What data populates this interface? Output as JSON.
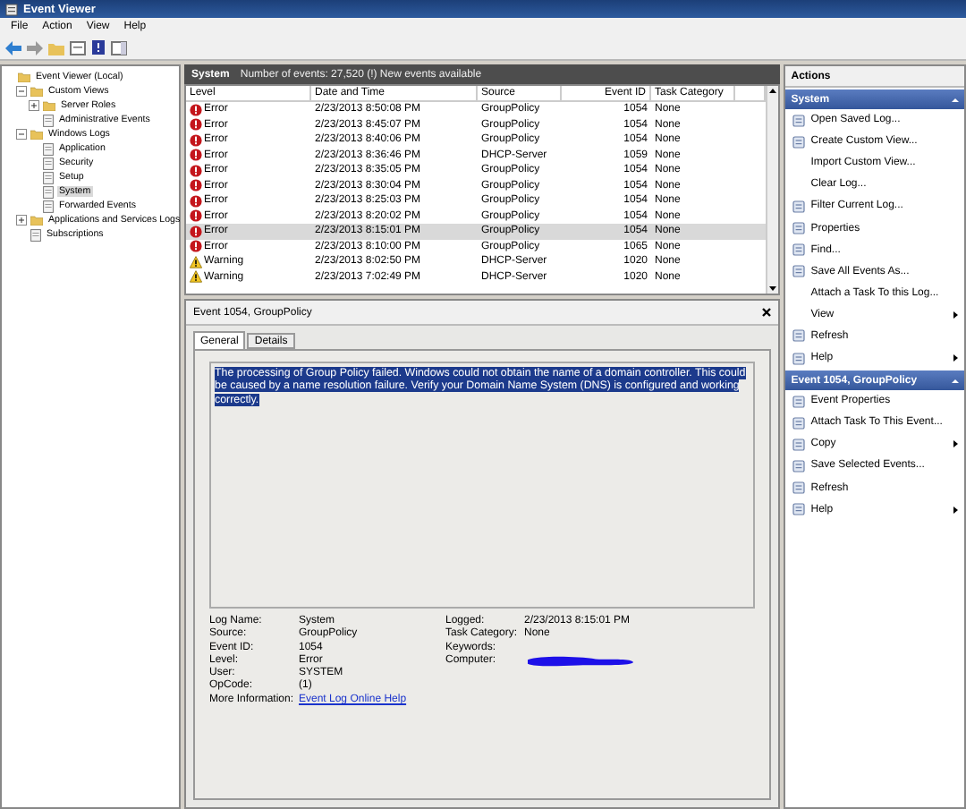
{
  "window": {
    "title": "Event Viewer"
  },
  "menu": [
    "File",
    "Action",
    "View",
    "Help"
  ],
  "tree": [
    {
      "label": "Event Viewer (Local)",
      "selected": false,
      "children": [
        {
          "label": "Custom Views",
          "selected": false,
          "expanded": true,
          "children": [
            {
              "label": "Server Roles",
              "selected": false,
              "expanded": false
            },
            {
              "label": "Administrative Events",
              "selected": false
            }
          ]
        },
        {
          "label": "Windows Logs",
          "selected": false,
          "expanded": true,
          "children": [
            {
              "label": "Application",
              "selected": false
            },
            {
              "label": "Security",
              "selected": false
            },
            {
              "label": "Setup",
              "selected": false
            },
            {
              "label": "System",
              "selected": true
            },
            {
              "label": "Forwarded Events",
              "selected": false
            }
          ]
        },
        {
          "label": "Applications and Services Logs",
          "selected": false,
          "expanded": false
        },
        {
          "label": "Subscriptions",
          "selected": false
        }
      ]
    }
  ],
  "log_header": {
    "title": "System",
    "summary": "Number of events: 27,520 (!) New events available"
  },
  "table": {
    "columns": [
      "Level",
      "Date and Time",
      "Source",
      "Event ID",
      "Task Category"
    ],
    "rows": [
      {
        "kind": "error",
        "level": "Error",
        "date": "2/23/2013 8:50:08 PM",
        "source": "GroupPolicy",
        "event_id": "1054",
        "task": "None",
        "selected": false
      },
      {
        "kind": "error",
        "level": "Error",
        "date": "2/23/2013 8:45:07 PM",
        "source": "GroupPolicy",
        "event_id": "1054",
        "task": "None",
        "selected": false
      },
      {
        "kind": "error",
        "level": "Error",
        "date": "2/23/2013 8:40:06 PM",
        "source": "GroupPolicy",
        "event_id": "1054",
        "task": "None",
        "selected": false
      },
      {
        "kind": "error",
        "level": "Error",
        "date": "2/23/2013 8:36:46 PM",
        "source": "DHCP-Server",
        "event_id": "1059",
        "task": "None",
        "selected": false
      },
      {
        "kind": "error",
        "level": "Error",
        "date": "2/23/2013 8:35:05 PM",
        "source": "GroupPolicy",
        "event_id": "1054",
        "task": "None",
        "selected": false
      },
      {
        "kind": "error",
        "level": "Error",
        "date": "2/23/2013 8:30:04 PM",
        "source": "GroupPolicy",
        "event_id": "1054",
        "task": "None",
        "selected": false
      },
      {
        "kind": "error",
        "level": "Error",
        "date": "2/23/2013 8:25:03 PM",
        "source": "GroupPolicy",
        "event_id": "1054",
        "task": "None",
        "selected": false
      },
      {
        "kind": "error",
        "level": "Error",
        "date": "2/23/2013 8:20:02 PM",
        "source": "GroupPolicy",
        "event_id": "1054",
        "task": "None",
        "selected": false
      },
      {
        "kind": "error",
        "level": "Error",
        "date": "2/23/2013 8:15:01 PM",
        "source": "GroupPolicy",
        "event_id": "1054",
        "task": "None",
        "selected": true
      },
      {
        "kind": "error",
        "level": "Error",
        "date": "2/23/2013 8:10:00 PM",
        "source": "GroupPolicy",
        "event_id": "1065",
        "task": "None",
        "selected": false
      },
      {
        "kind": "warning",
        "level": "Warning",
        "date": "2/23/2013 8:02:50 PM",
        "source": "DHCP-Server",
        "event_id": "1020",
        "task": "None",
        "selected": false
      },
      {
        "kind": "warning",
        "level": "Warning",
        "date": "2/23/2013 7:02:49 PM",
        "source": "DHCP-Server",
        "event_id": "1020",
        "task": "None",
        "selected": false
      }
    ]
  },
  "detail": {
    "title": "Event 1054, GroupPolicy",
    "tabs": [
      {
        "label": "General",
        "selected": true
      },
      {
        "label": "Details",
        "selected": false
      }
    ],
    "description": "The processing of Group Policy failed. Windows could not obtain the name of a domain controller. This could be caused by a name resolution failure. Verify your Domain Name System (DNS) is configured and working correctly.",
    "fields_left": [
      {
        "label": "Log Name:",
        "value": "System"
      },
      {
        "label": "Source:",
        "value": "GroupPolicy"
      },
      {
        "label": "Event ID:",
        "value": "1054"
      },
      {
        "label": "Level:",
        "value": "Error"
      },
      {
        "label": "User:",
        "value": "SYSTEM"
      },
      {
        "label": "OpCode:",
        "value": "(1)"
      }
    ],
    "fields_right": [
      {
        "label": "Logged:",
        "value": "2/23/2013 8:15:01 PM"
      },
      {
        "label": "Task Category:",
        "value": "None"
      },
      {
        "label": "Keywords:"
      },
      {
        "label": "Computer:",
        "redacted": true
      }
    ],
    "more_info": {
      "label": "More Information:",
      "link": "Event Log Online Help"
    }
  },
  "actions": {
    "title": "Actions",
    "sections": [
      {
        "title": "System",
        "items": [
          {
            "label": "Open Saved Log...",
            "has_icon": true,
            "submenu": false
          },
          {
            "label": "Create Custom View...",
            "has_icon": true,
            "submenu": false
          },
          {
            "label": "Import Custom View...",
            "has_icon": false,
            "submenu": false
          },
          {
            "label": "Clear Log...",
            "has_icon": false,
            "submenu": false
          },
          {
            "label": "Filter Current Log...",
            "has_icon": true,
            "submenu": false
          },
          {
            "label": "Properties",
            "has_icon": true,
            "submenu": false
          },
          {
            "label": "Find...",
            "has_icon": true,
            "submenu": false
          },
          {
            "label": "Save All Events As...",
            "has_icon": true,
            "submenu": false
          },
          {
            "label": "Attach a Task To this Log...",
            "has_icon": false,
            "submenu": false
          },
          {
            "label": "View",
            "has_icon": false,
            "submenu": true
          },
          {
            "label": "Refresh",
            "has_icon": true,
            "submenu": false
          },
          {
            "label": "Help",
            "has_icon": true,
            "submenu": true
          }
        ]
      },
      {
        "title": "Event 1054, GroupPolicy",
        "items": [
          {
            "label": "Event Properties",
            "has_icon": true,
            "submenu": false
          },
          {
            "label": "Attach Task To This Event...",
            "has_icon": true,
            "submenu": false
          },
          {
            "label": "Copy",
            "has_icon": true,
            "submenu": true
          },
          {
            "label": "Save Selected Events...",
            "has_icon": true,
            "submenu": false
          },
          {
            "label": "Refresh",
            "has_icon": true,
            "submenu": false
          },
          {
            "label": "Help",
            "has_icon": true,
            "submenu": true
          }
        ]
      }
    ]
  }
}
